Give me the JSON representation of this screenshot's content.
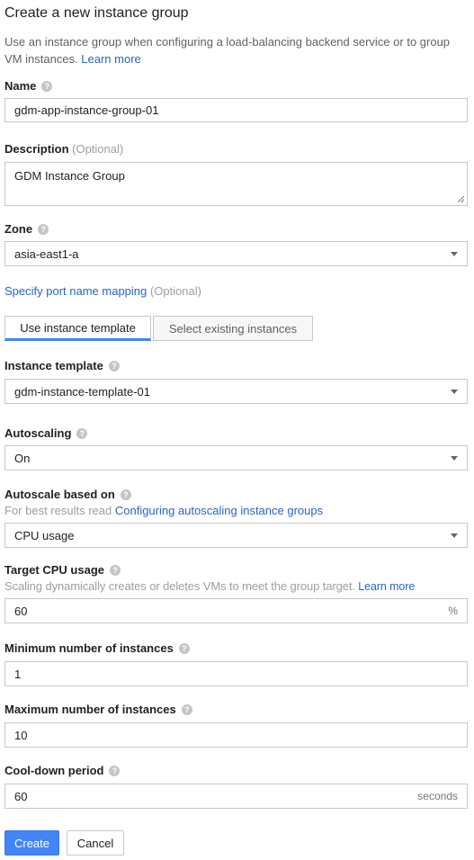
{
  "header": {
    "title": "Create a new instance group",
    "intro": "Use an instance group when configuring a load-balancing backend service or to group VM instances.",
    "learn_more": "Learn more"
  },
  "name": {
    "label": "Name",
    "value": "gdm-app-instance-group-01"
  },
  "description": {
    "label": "Description",
    "optional": "(Optional)",
    "value": "GDM Instance Group"
  },
  "zone": {
    "label": "Zone",
    "value": "asia-east1-a"
  },
  "port_mapping": {
    "link": "Specify port name mapping",
    "optional": "(Optional)"
  },
  "tabs": [
    {
      "label": "Use instance template",
      "active": true
    },
    {
      "label": "Select existing instances",
      "active": false
    }
  ],
  "instance_template": {
    "label": "Instance template",
    "value": "gdm-instance-template-01"
  },
  "autoscaling": {
    "label": "Autoscaling",
    "value": "On"
  },
  "autoscale_based_on": {
    "label": "Autoscale based on",
    "hint_prefix": "For best results read",
    "hint_link": "Configuring autoscaling instance groups",
    "value": "CPU usage"
  },
  "target_cpu": {
    "label": "Target CPU usage",
    "hint": "Scaling dynamically creates or deletes VMs to meet the group target.",
    "hint_link": "Learn more",
    "value": "60",
    "suffix": "%"
  },
  "min_instances": {
    "label": "Minimum number of instances",
    "value": "1"
  },
  "max_instances": {
    "label": "Maximum number of instances",
    "value": "10"
  },
  "cooldown": {
    "label": "Cool-down period",
    "value": "60",
    "suffix": "seconds"
  },
  "actions": {
    "create": "Create",
    "cancel": "Cancel"
  },
  "colors": {
    "accent": "#4285f4",
    "link": "#2a63c7",
    "hint": "#9e9e9e"
  },
  "icons": {
    "help": "help-icon",
    "dropdown": "chevron-down-icon",
    "resize": "resize-handle-icon"
  }
}
